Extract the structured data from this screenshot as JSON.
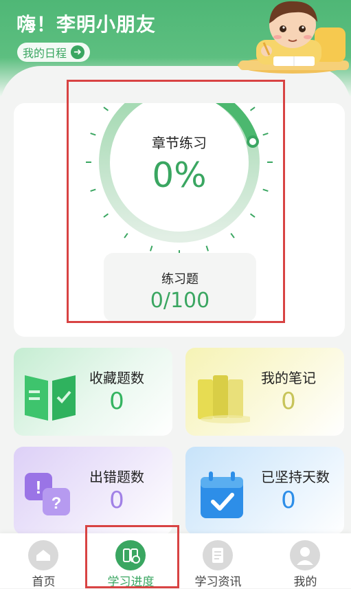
{
  "header": {
    "greeting": "嗨！李明小朋友",
    "schedule_label": "我的日程"
  },
  "progress": {
    "title": "章节练习",
    "percent_text": "0%",
    "percent": 0,
    "exercise_label": "练习题",
    "exercise_value": "0/100"
  },
  "stats": [
    {
      "label": "收藏题数",
      "value": "0",
      "icon": "open-book-check-icon",
      "color": "#35b461"
    },
    {
      "label": "我的笔记",
      "value": "0",
      "icon": "notebooks-icon",
      "color": "#c7c45a"
    },
    {
      "label": "出错题数",
      "value": "0",
      "icon": "question-bubble-icon",
      "color": "#a181e6"
    },
    {
      "label": "已坚持天数",
      "value": "0",
      "icon": "calendar-check-icon",
      "color": "#2d8ee8"
    }
  ],
  "tabs": [
    {
      "label": "首页",
      "icon": "home-icon",
      "active": false
    },
    {
      "label": "学习进度",
      "icon": "study-progress-icon",
      "active": true
    },
    {
      "label": "学习资讯",
      "icon": "news-icon",
      "active": false
    },
    {
      "label": "我的",
      "icon": "profile-icon",
      "active": false
    }
  ],
  "colors": {
    "primary": "#3aa661",
    "highlight": "#d84343"
  }
}
